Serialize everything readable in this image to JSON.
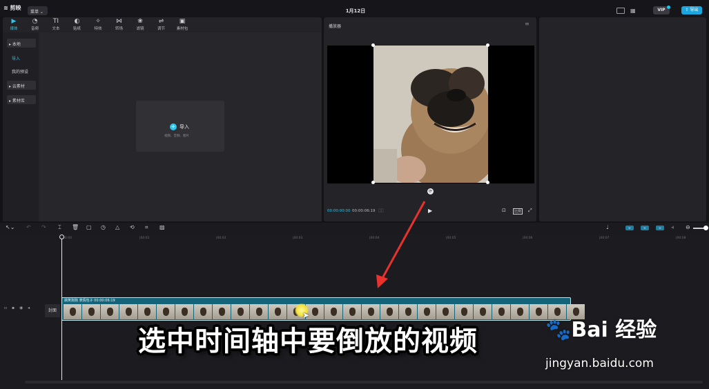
{
  "app": {
    "logo": "剪映",
    "menu": "菜单",
    "title": "1月12日",
    "vip": "VIP",
    "export": "导出"
  },
  "tool_tabs": [
    {
      "label": "媒体",
      "icon": "media-icon",
      "glyph": "▶"
    },
    {
      "label": "音频",
      "icon": "audio-icon",
      "glyph": "◔"
    },
    {
      "label": "文本",
      "icon": "text-icon",
      "glyph": "TI"
    },
    {
      "label": "贴纸",
      "icon": "sticker-icon",
      "glyph": "◐"
    },
    {
      "label": "特效",
      "icon": "effects-icon",
      "glyph": "✧"
    },
    {
      "label": "转场",
      "icon": "transition-icon",
      "glyph": "⋈"
    },
    {
      "label": "滤镜",
      "icon": "filter-icon",
      "glyph": "❀"
    },
    {
      "label": "调节",
      "icon": "adjust-icon",
      "glyph": "⇌"
    },
    {
      "label": "素材包",
      "icon": "package-icon",
      "glyph": "▣"
    }
  ],
  "sidebar": {
    "local": "▸ 本地",
    "import": "导入",
    "presets": "我的预设",
    "cloud": "▸ 云素材",
    "library": "▸ 素材库"
  },
  "import": {
    "label": "导入",
    "hint": "视频、音频、图片"
  },
  "player": {
    "title": "播放器",
    "current_time": "00:00:00:00",
    "total_time": "00:00:06:19",
    "ratio": "比例"
  },
  "timeline": {
    "ticks": [
      "00:00",
      "|00:01",
      "|00:02",
      "|00:03",
      "|00:04",
      "|00:05",
      "|00:06",
      "|00:07",
      "|00:08"
    ],
    "cover": "封面",
    "clip_label": "搞笑狗狗 表情包子  00:00:06:19",
    "thumb_count": 28
  },
  "overlay": {
    "caption": "选中时间轴中要倒放的视频",
    "watermark_logo": "Bai 经验",
    "watermark_url": "jingyan.baidu.com"
  },
  "colors": {
    "accent": "#2dc3ea",
    "clip": "#136479",
    "annotation_arrow": "#e8322e"
  }
}
